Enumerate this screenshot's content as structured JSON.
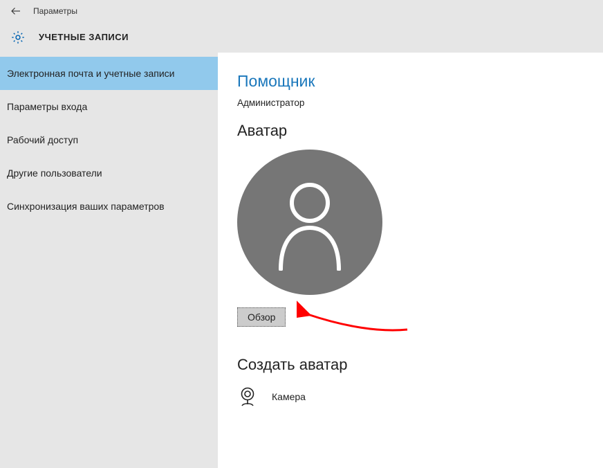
{
  "titlebar": {
    "title": "Параметры"
  },
  "header": {
    "title": "УЧЕТНЫЕ ЗАПИСИ"
  },
  "sidebar": {
    "items": [
      {
        "label": "Электронная почта и учетные записи",
        "selected": true
      },
      {
        "label": "Параметры входа",
        "selected": false
      },
      {
        "label": "Рабочий доступ",
        "selected": false
      },
      {
        "label": "Другие пользователи",
        "selected": false
      },
      {
        "label": "Синхронизация ваших параметров",
        "selected": false
      }
    ]
  },
  "content": {
    "account_name": "Помощник",
    "role": "Администратор",
    "avatar_section_title": "Аватар",
    "browse_button": "Обзор",
    "create_section_title": "Создать аватар",
    "camera_label": "Камера"
  },
  "colors": {
    "accent": "#1a77bb",
    "sidebar_bg": "#e6e6e6",
    "selected_bg": "#91c9ec",
    "avatar_fill": "#767676",
    "annotation": "#ff0000"
  }
}
